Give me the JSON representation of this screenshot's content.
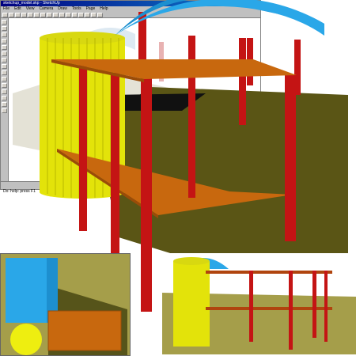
{
  "window": {
    "title": "sketchup_model.skp - SketchUp",
    "menu": [
      "File",
      "Edit",
      "View",
      "Camera",
      "Draw",
      "Tools",
      "Page",
      "Help"
    ],
    "status": "Do: help: press F1"
  },
  "colors": {
    "roof": "#2aa7e8",
    "post": "#c41414",
    "deck": "#c8680e",
    "cylinder": "#e3e30a",
    "shadow": "#5a5515",
    "ground": "#a59e4a"
  },
  "icons": [
    "select-tool-icon",
    "eraser-icon",
    "paint-icon",
    "rectangle-icon",
    "circle-icon",
    "line-icon",
    "push-pull-icon",
    "move-icon",
    "rotate-icon",
    "orbit-icon",
    "zoom-icon"
  ]
}
